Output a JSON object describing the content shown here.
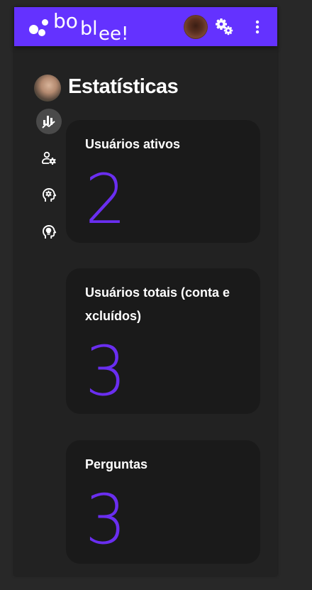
{
  "brand": {
    "name": "boblee!",
    "part1": "bo",
    "part2": "bl",
    "part3": "ee!",
    "color": "#6432ff"
  },
  "topbar": {
    "settings_icon": "gears-icon",
    "menu_icon": "more-vert-icon"
  },
  "sidebar": {
    "items": [
      {
        "name": "statistics",
        "icon": "chart-icon",
        "active": true
      },
      {
        "name": "user-settings",
        "icon": "user-gear-icon",
        "active": false
      },
      {
        "name": "head-settings",
        "icon": "head-gear-icon",
        "active": false
      },
      {
        "name": "head-idea",
        "icon": "head-lightbulb-icon",
        "active": false
      }
    ]
  },
  "page": {
    "title": "Estatísticas"
  },
  "stats": [
    {
      "title": "Usuários ativos",
      "value": "2"
    },
    {
      "title": "Usuários totais (conta e xcluídos)",
      "value": "3"
    },
    {
      "title": "Perguntas",
      "value": "3"
    }
  ],
  "colors": {
    "accent": "#6432ff",
    "value": "#6a2ef0",
    "card": "#1a1a1a",
    "background": "#222222"
  }
}
